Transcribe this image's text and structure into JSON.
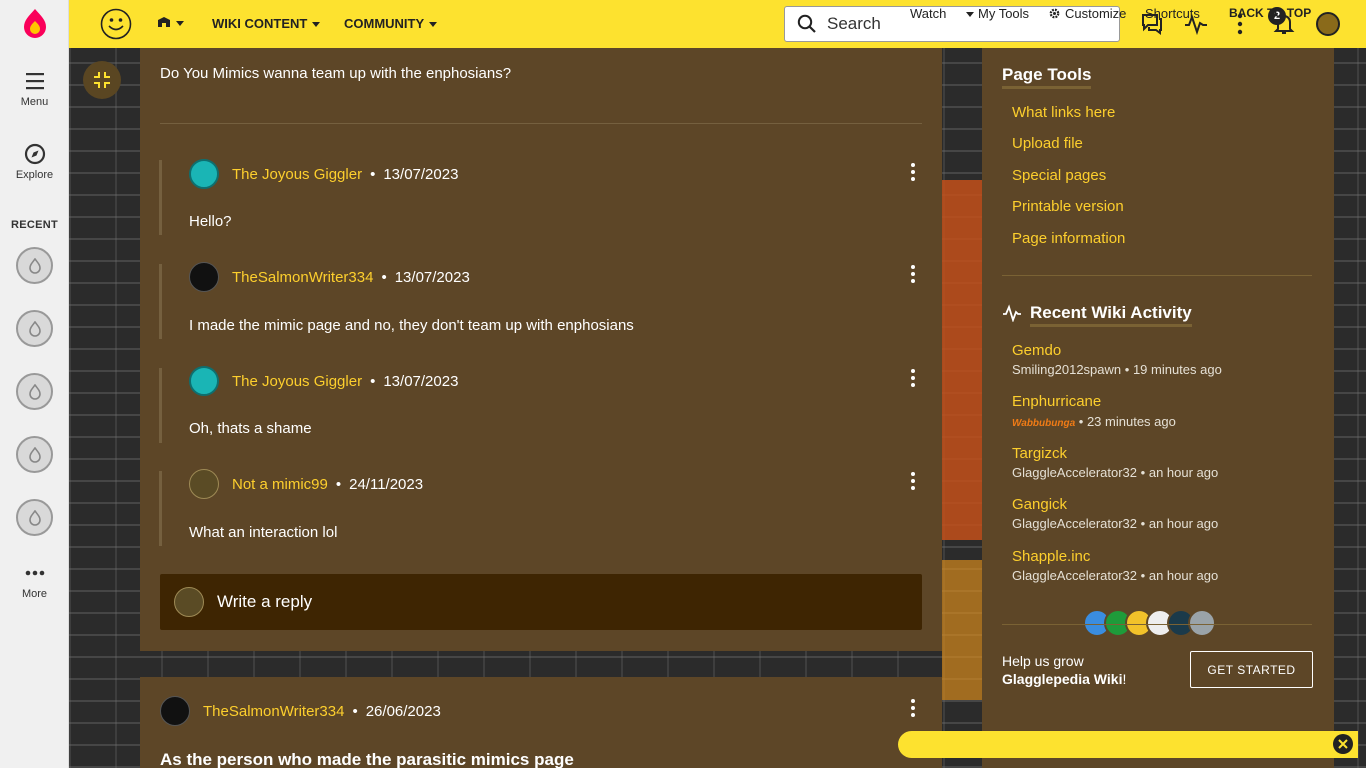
{
  "global_nav": {
    "menu_label": "Menu",
    "explore_label": "Explore",
    "recent_label": "RECENT",
    "more_label": "More"
  },
  "topbar": {
    "wiki_content_label": "WIKI CONTENT",
    "community_label": "COMMUNITY",
    "search_placeholder": "Search",
    "notification_count": "2"
  },
  "thread": {
    "opening_text": "Do You Mimics wanna team up with the enphosians?",
    "replies": [
      {
        "author": "The Joyous Giggler",
        "date": "13/07/2023",
        "text": "Hello?"
      },
      {
        "author": "TheSalmonWriter334",
        "date": "13/07/2023",
        "text": "I made the mimic page and no, they don't team up with enphosians"
      },
      {
        "author": "The Joyous Giggler",
        "date": "13/07/2023",
        "text": "Oh, thats a shame"
      },
      {
        "author": "Not a mimic99",
        "date": "24/11/2023",
        "text": "What an interaction lol"
      }
    ],
    "write_reply_placeholder": "Write a reply",
    "separator": "•"
  },
  "next_post": {
    "author": "TheSalmonWriter334",
    "date": "26/06/2023",
    "title": "As the person who made the parasitic mimics page"
  },
  "right_rail": {
    "page_tools_heading": "Page Tools",
    "page_tools": [
      "What links here",
      "Upload file",
      "Special pages",
      "Printable version",
      "Page information"
    ],
    "activity_heading": "Recent Wiki Activity",
    "activity": [
      {
        "title": "Gemdo",
        "user": "Smiling2012spawn",
        "when": "19 minutes ago"
      },
      {
        "title": "Enphurricane",
        "user": "Wabbubunga",
        "when": "23 minutes ago"
      },
      {
        "title": "Targizck",
        "user": "GlaggleAccelerator32",
        "when": "an hour ago"
      },
      {
        "title": "Gangick",
        "user": "GlaggleAccelerator32",
        "when": "an hour ago"
      },
      {
        "title": "Shapple.inc",
        "user": "GlaggleAccelerator32",
        "when": "an hour ago"
      }
    ],
    "grow_text": "Help us grow",
    "wiki_name": "Glagglepedia Wiki",
    "grow_suffix": "!",
    "get_started_label": "GET STARTED"
  },
  "bottom_toolbar": {
    "watch": "Watch",
    "my_tools": "My Tools",
    "customize": "Customize",
    "shortcuts": "Shortcuts",
    "back_to_top": "BACK TO TOP"
  },
  "colors": {
    "accent": "#fde22f",
    "link": "#fdcf2d",
    "panel": "#5d4627",
    "reply_box": "#3e2502"
  }
}
